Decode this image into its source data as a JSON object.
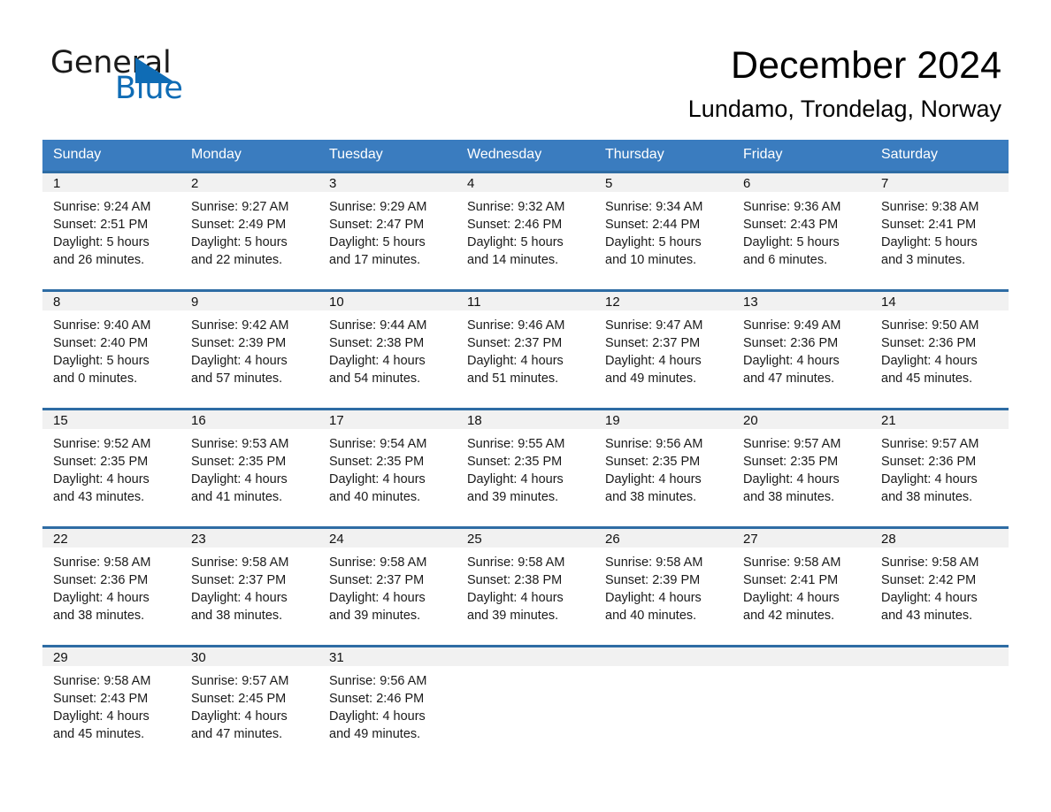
{
  "brand": {
    "word1": "General",
    "word2": "Blue",
    "triangle_color": "#0f6cb5",
    "text_color": "#1a1a1a"
  },
  "header": {
    "month_title": "December 2024",
    "location": "Lundamo, Trondelag, Norway"
  },
  "theme": {
    "header_row_bg": "#3a7cbf",
    "daynum_bg": "#f1f1f1",
    "daynum_rule": "#2e6ca4",
    "page_bg": "#ffffff"
  },
  "weekday_headers": [
    "Sunday",
    "Monday",
    "Tuesday",
    "Wednesday",
    "Thursday",
    "Friday",
    "Saturday"
  ],
  "weeks": [
    [
      {
        "day": "1",
        "sunrise": "Sunrise: 9:24 AM",
        "sunset": "Sunset: 2:51 PM",
        "daylight_line1": "Daylight: 5 hours",
        "daylight_line2": "and 26 minutes."
      },
      {
        "day": "2",
        "sunrise": "Sunrise: 9:27 AM",
        "sunset": "Sunset: 2:49 PM",
        "daylight_line1": "Daylight: 5 hours",
        "daylight_line2": "and 22 minutes."
      },
      {
        "day": "3",
        "sunrise": "Sunrise: 9:29 AM",
        "sunset": "Sunset: 2:47 PM",
        "daylight_line1": "Daylight: 5 hours",
        "daylight_line2": "and 17 minutes."
      },
      {
        "day": "4",
        "sunrise": "Sunrise: 9:32 AM",
        "sunset": "Sunset: 2:46 PM",
        "daylight_line1": "Daylight: 5 hours",
        "daylight_line2": "and 14 minutes."
      },
      {
        "day": "5",
        "sunrise": "Sunrise: 9:34 AM",
        "sunset": "Sunset: 2:44 PM",
        "daylight_line1": "Daylight: 5 hours",
        "daylight_line2": "and 10 minutes."
      },
      {
        "day": "6",
        "sunrise": "Sunrise: 9:36 AM",
        "sunset": "Sunset: 2:43 PM",
        "daylight_line1": "Daylight: 5 hours",
        "daylight_line2": "and 6 minutes."
      },
      {
        "day": "7",
        "sunrise": "Sunrise: 9:38 AM",
        "sunset": "Sunset: 2:41 PM",
        "daylight_line1": "Daylight: 5 hours",
        "daylight_line2": "and 3 minutes."
      }
    ],
    [
      {
        "day": "8",
        "sunrise": "Sunrise: 9:40 AM",
        "sunset": "Sunset: 2:40 PM",
        "daylight_line1": "Daylight: 5 hours",
        "daylight_line2": "and 0 minutes."
      },
      {
        "day": "9",
        "sunrise": "Sunrise: 9:42 AM",
        "sunset": "Sunset: 2:39 PM",
        "daylight_line1": "Daylight: 4 hours",
        "daylight_line2": "and 57 minutes."
      },
      {
        "day": "10",
        "sunrise": "Sunrise: 9:44 AM",
        "sunset": "Sunset: 2:38 PM",
        "daylight_line1": "Daylight: 4 hours",
        "daylight_line2": "and 54 minutes."
      },
      {
        "day": "11",
        "sunrise": "Sunrise: 9:46 AM",
        "sunset": "Sunset: 2:37 PM",
        "daylight_line1": "Daylight: 4 hours",
        "daylight_line2": "and 51 minutes."
      },
      {
        "day": "12",
        "sunrise": "Sunrise: 9:47 AM",
        "sunset": "Sunset: 2:37 PM",
        "daylight_line1": "Daylight: 4 hours",
        "daylight_line2": "and 49 minutes."
      },
      {
        "day": "13",
        "sunrise": "Sunrise: 9:49 AM",
        "sunset": "Sunset: 2:36 PM",
        "daylight_line1": "Daylight: 4 hours",
        "daylight_line2": "and 47 minutes."
      },
      {
        "day": "14",
        "sunrise": "Sunrise: 9:50 AM",
        "sunset": "Sunset: 2:36 PM",
        "daylight_line1": "Daylight: 4 hours",
        "daylight_line2": "and 45 minutes."
      }
    ],
    [
      {
        "day": "15",
        "sunrise": "Sunrise: 9:52 AM",
        "sunset": "Sunset: 2:35 PM",
        "daylight_line1": "Daylight: 4 hours",
        "daylight_line2": "and 43 minutes."
      },
      {
        "day": "16",
        "sunrise": "Sunrise: 9:53 AM",
        "sunset": "Sunset: 2:35 PM",
        "daylight_line1": "Daylight: 4 hours",
        "daylight_line2": "and 41 minutes."
      },
      {
        "day": "17",
        "sunrise": "Sunrise: 9:54 AM",
        "sunset": "Sunset: 2:35 PM",
        "daylight_line1": "Daylight: 4 hours",
        "daylight_line2": "and 40 minutes."
      },
      {
        "day": "18",
        "sunrise": "Sunrise: 9:55 AM",
        "sunset": "Sunset: 2:35 PM",
        "daylight_line1": "Daylight: 4 hours",
        "daylight_line2": "and 39 minutes."
      },
      {
        "day": "19",
        "sunrise": "Sunrise: 9:56 AM",
        "sunset": "Sunset: 2:35 PM",
        "daylight_line1": "Daylight: 4 hours",
        "daylight_line2": "and 38 minutes."
      },
      {
        "day": "20",
        "sunrise": "Sunrise: 9:57 AM",
        "sunset": "Sunset: 2:35 PM",
        "daylight_line1": "Daylight: 4 hours",
        "daylight_line2": "and 38 minutes."
      },
      {
        "day": "21",
        "sunrise": "Sunrise: 9:57 AM",
        "sunset": "Sunset: 2:36 PM",
        "daylight_line1": "Daylight: 4 hours",
        "daylight_line2": "and 38 minutes."
      }
    ],
    [
      {
        "day": "22",
        "sunrise": "Sunrise: 9:58 AM",
        "sunset": "Sunset: 2:36 PM",
        "daylight_line1": "Daylight: 4 hours",
        "daylight_line2": "and 38 minutes."
      },
      {
        "day": "23",
        "sunrise": "Sunrise: 9:58 AM",
        "sunset": "Sunset: 2:37 PM",
        "daylight_line1": "Daylight: 4 hours",
        "daylight_line2": "and 38 minutes."
      },
      {
        "day": "24",
        "sunrise": "Sunrise: 9:58 AM",
        "sunset": "Sunset: 2:37 PM",
        "daylight_line1": "Daylight: 4 hours",
        "daylight_line2": "and 39 minutes."
      },
      {
        "day": "25",
        "sunrise": "Sunrise: 9:58 AM",
        "sunset": "Sunset: 2:38 PM",
        "daylight_line1": "Daylight: 4 hours",
        "daylight_line2": "and 39 minutes."
      },
      {
        "day": "26",
        "sunrise": "Sunrise: 9:58 AM",
        "sunset": "Sunset: 2:39 PM",
        "daylight_line1": "Daylight: 4 hours",
        "daylight_line2": "and 40 minutes."
      },
      {
        "day": "27",
        "sunrise": "Sunrise: 9:58 AM",
        "sunset": "Sunset: 2:41 PM",
        "daylight_line1": "Daylight: 4 hours",
        "daylight_line2": "and 42 minutes."
      },
      {
        "day": "28",
        "sunrise": "Sunrise: 9:58 AM",
        "sunset": "Sunset: 2:42 PM",
        "daylight_line1": "Daylight: 4 hours",
        "daylight_line2": "and 43 minutes."
      }
    ],
    [
      {
        "day": "29",
        "sunrise": "Sunrise: 9:58 AM",
        "sunset": "Sunset: 2:43 PM",
        "daylight_line1": "Daylight: 4 hours",
        "daylight_line2": "and 45 minutes."
      },
      {
        "day": "30",
        "sunrise": "Sunrise: 9:57 AM",
        "sunset": "Sunset: 2:45 PM",
        "daylight_line1": "Daylight: 4 hours",
        "daylight_line2": "and 47 minutes."
      },
      {
        "day": "31",
        "sunrise": "Sunrise: 9:56 AM",
        "sunset": "Sunset: 2:46 PM",
        "daylight_line1": "Daylight: 4 hours",
        "daylight_line2": "and 49 minutes."
      },
      {
        "day": "",
        "sunrise": "",
        "sunset": "",
        "daylight_line1": "",
        "daylight_line2": ""
      },
      {
        "day": "",
        "sunrise": "",
        "sunset": "",
        "daylight_line1": "",
        "daylight_line2": ""
      },
      {
        "day": "",
        "sunrise": "",
        "sunset": "",
        "daylight_line1": "",
        "daylight_line2": ""
      },
      {
        "day": "",
        "sunrise": "",
        "sunset": "",
        "daylight_line1": "",
        "daylight_line2": ""
      }
    ]
  ]
}
